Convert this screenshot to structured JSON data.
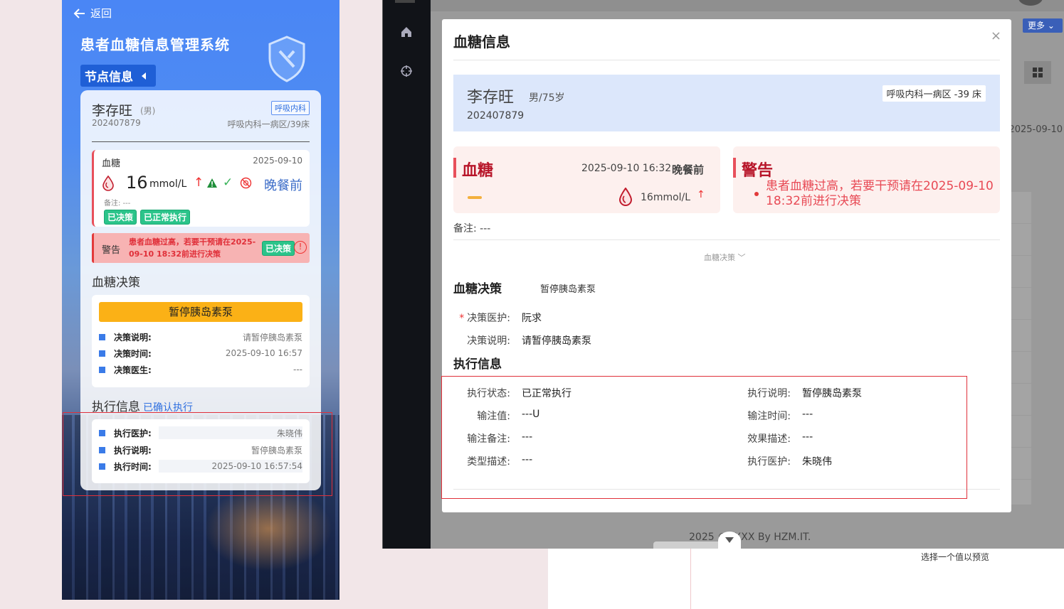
{
  "mobile": {
    "back_label": "返回",
    "system_title": "患者血糖信息管理系统",
    "node_info_label": "节点信息",
    "patient": {
      "name": "李存旺",
      "sex": "(男)",
      "dept_tag": "呼吸内科",
      "id": "202407879",
      "bed": "呼吸内科一病区/39床"
    },
    "blood_sugar": {
      "label": "血糖",
      "date": "2025-09-10",
      "value": "16",
      "unit": "mmol/L",
      "up_arrow": "↑",
      "check": "✓",
      "meal": "晚餐前",
      "note": "备注: ---",
      "tags": [
        "已决策",
        "已正常执行"
      ]
    },
    "warning": {
      "label": "警告",
      "text": "患者血糖过高，若要干预请在2025-09-10 18:32前进行决策",
      "tag": "已决策",
      "icon_text": "!"
    },
    "decision": {
      "title": "血糖决策",
      "action": "暂停胰岛素泵",
      "rows": [
        {
          "key": "决策说明:",
          "value": "请暂停胰岛素泵"
        },
        {
          "key": "决策时间:",
          "value": "2025-09-10 16:57"
        },
        {
          "key": "决策医生:",
          "value": "---"
        }
      ]
    },
    "execution": {
      "title": "执行信息",
      "status": "已确认执行",
      "rows": [
        {
          "key": "执行医护:",
          "value": "朱晓伟"
        },
        {
          "key": "执行说明:",
          "value": "暂停胰岛素泵"
        },
        {
          "key": "执行时间:",
          "value": "2025-09-10 16:57:54"
        }
      ]
    }
  },
  "desktop": {
    "more_button": "更多",
    "bg_date": "2025-09-10",
    "footer": "2025 ©XXXX By HZM.IT.",
    "preview_hint": "选择一个值以预览"
  },
  "dialog": {
    "title": "血糖信息",
    "close": "×",
    "patient": {
      "name": "李存旺",
      "sex_age": "男/75岁",
      "id": "202407879",
      "bed": "呼吸内科一病区 -39 床"
    },
    "blood_sugar": {
      "label": "血糖",
      "datetime": "2025-09-10 16:32",
      "meal": "晚餐前",
      "value": "16mmol/L",
      "up_arrow": "↑"
    },
    "warning": {
      "label": "警告",
      "text": "患者血糖过高，若要干预请在2025-09-10 18:32前进行决策"
    },
    "note": "备注: ---",
    "fold_label": "血糖决策",
    "decision": {
      "title": "血糖决策",
      "action": "暂停胰岛素泵",
      "doctor_key": "决策医护:",
      "doctor_value": "阮求",
      "desc_key": "决策说明:",
      "desc_value": "请暂停胰岛素泵"
    },
    "execution": {
      "title": "执行信息",
      "left": [
        {
          "key": "执行状态:",
          "value": "已正常执行"
        },
        {
          "key": "输注值:",
          "value": "---U"
        },
        {
          "key": "输注备注:",
          "value": "---"
        },
        {
          "key": "类型描述:",
          "value": "---"
        }
      ],
      "right": [
        {
          "key": "执行说明:",
          "value": "暂停胰岛素泵"
        },
        {
          "key": "输注时间:",
          "value": "---"
        },
        {
          "key": "效果描述:",
          "value": "---"
        },
        {
          "key": "执行医护:",
          "value": "朱晓伟"
        }
      ]
    }
  },
  "colors": {
    "accent_blue": "#2f6fe0",
    "warning_red": "#e23a3a",
    "decision_yellow": "#fbb116",
    "tag_green": "#2bc48a"
  }
}
